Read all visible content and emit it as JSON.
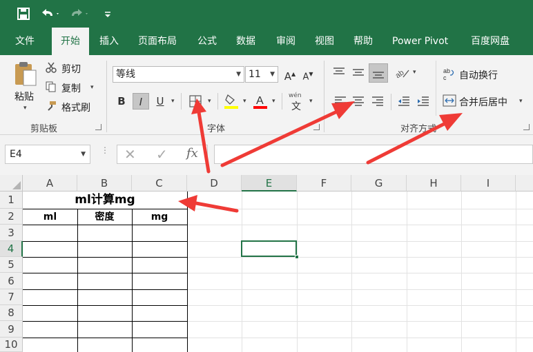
{
  "qat": {
    "save_icon": "save-icon",
    "undo_icon": "undo-icon",
    "redo_icon": "redo-icon",
    "customize_icon": "customize-icon"
  },
  "tabs": [
    "文件",
    "开始",
    "插入",
    "页面布局",
    "公式",
    "数据",
    "审阅",
    "视图",
    "帮助",
    "Power Pivot",
    "百度网盘"
  ],
  "active_tab": "开始",
  "clipboard": {
    "paste": "粘贴",
    "cut": "剪切",
    "copy": "复制",
    "format_painter": "格式刷",
    "group": "剪贴板"
  },
  "font": {
    "name": "等线",
    "size": "11",
    "bold": "B",
    "italic": "I",
    "underline": "U",
    "fill_color": "#ffff00",
    "font_color": "#ff0000",
    "phonetic": "wén",
    "group": "字体"
  },
  "alignment": {
    "wrap_text": "自动换行",
    "merge_center": "合并后居中",
    "group": "对齐方式"
  },
  "number_group_partial": "刷",
  "formula_bar": {
    "name_box": "E4",
    "fx": "fx",
    "value": ""
  },
  "columns": [
    "A",
    "B",
    "C",
    "D",
    "E",
    "F",
    "G",
    "H",
    "I"
  ],
  "rows": [
    "1",
    "2",
    "3",
    "4",
    "5",
    "6",
    "7",
    "8",
    "9",
    "10"
  ],
  "selected_cell": "E4",
  "cells": {
    "title": "ml计算mg",
    "a2": "ml",
    "b2": "密度",
    "c2": "mg"
  },
  "colors": {
    "accent": "#217346",
    "arrow": "#ef3b36"
  }
}
